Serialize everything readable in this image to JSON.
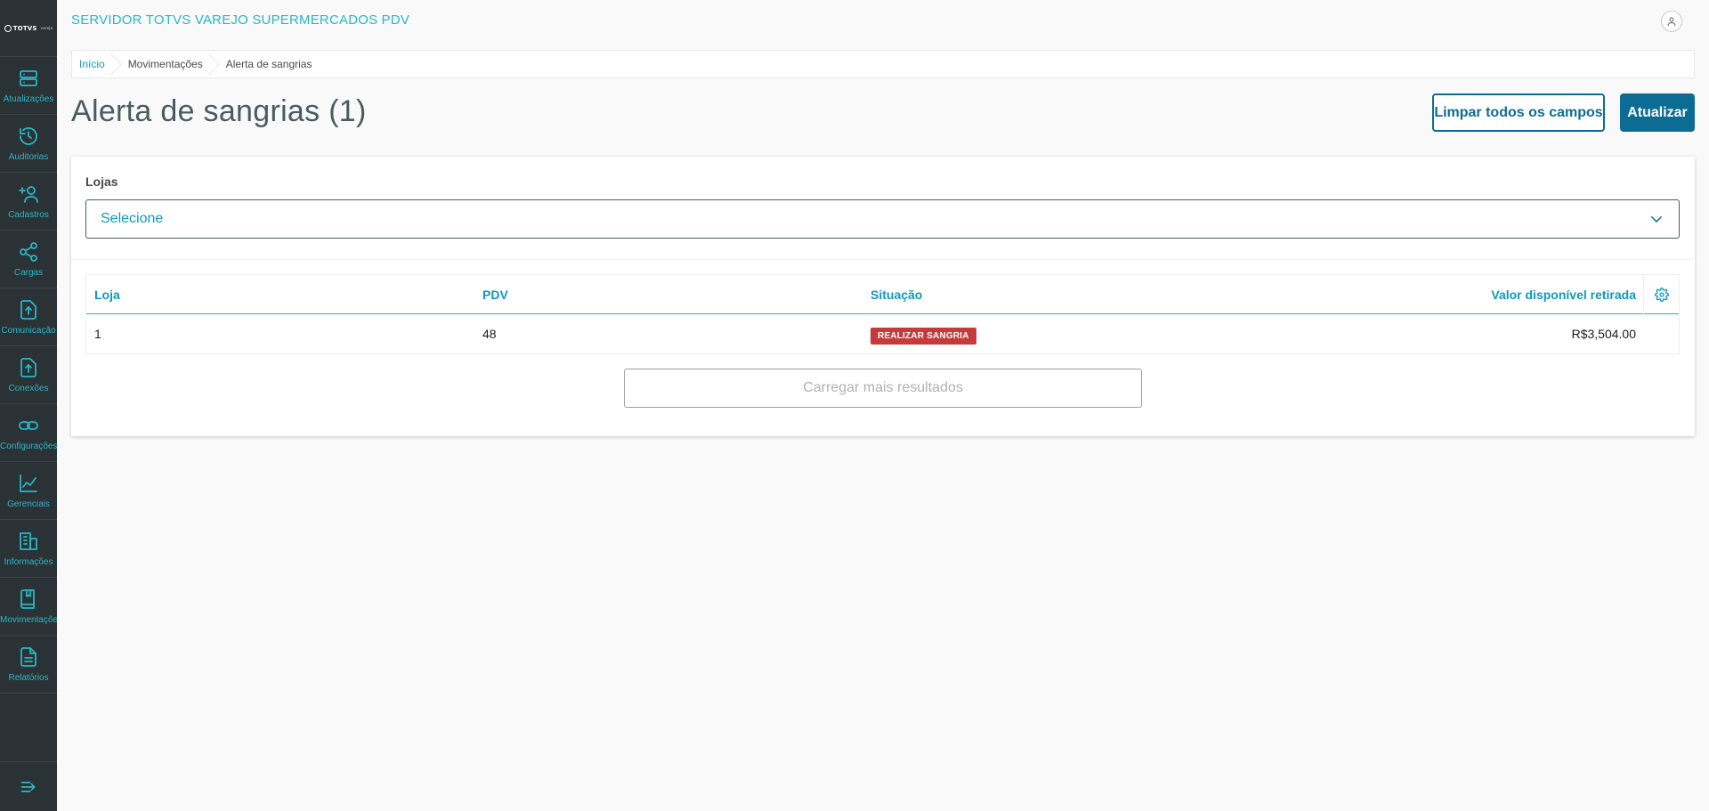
{
  "app": {
    "title": "SERVIDOR TOTVS VAREJO SUPERMERCADOS PDV",
    "logo_text": "TOTVS",
    "logo_sub": "varejo"
  },
  "sidebar": {
    "items": [
      {
        "label": "Atualizações",
        "icon": "server-icon"
      },
      {
        "label": "Auditorias",
        "icon": "history-icon"
      },
      {
        "label": "Cadastros",
        "icon": "user-plus-icon"
      },
      {
        "label": "Cargas",
        "icon": "share-icon"
      },
      {
        "label": "Comunicação",
        "icon": "upload-file-icon"
      },
      {
        "label": "Conexões",
        "icon": "upload-file-icon"
      },
      {
        "label": "Configurações",
        "icon": "link-icon"
      },
      {
        "label": "Gerenciais",
        "icon": "chart-icon"
      },
      {
        "label": "Informações",
        "icon": "building-icon"
      },
      {
        "label": "Movimentações",
        "icon": "book-icon"
      },
      {
        "label": "Relatórios",
        "icon": "document-icon"
      }
    ],
    "collapse_icon": "menu-collapse-icon"
  },
  "breadcrumb": {
    "items": [
      "Início",
      "Movimentações",
      "Alerta de sangrias"
    ]
  },
  "page": {
    "title": "Alerta de sangrias (1)"
  },
  "actions": {
    "clear_label": "Limpar todos os campos",
    "refresh_label": "Atualizar"
  },
  "filter": {
    "label": "Lojas",
    "placeholder": "Selecione"
  },
  "table": {
    "columns": [
      "Loja",
      "PDV",
      "Situação",
      "Valor disponível retirada"
    ],
    "rows": [
      {
        "loja": "1",
        "pdv": "48",
        "situacao": "REALIZAR SANGRIA",
        "valor": "R$3,504.00"
      }
    ],
    "load_more_label": "Carregar mais resultados"
  },
  "colors": {
    "sidebar_bg": "#2b3236",
    "accent": "#29b6c5",
    "primary": "#0c6c94",
    "badge_danger": "#c53b3b"
  }
}
